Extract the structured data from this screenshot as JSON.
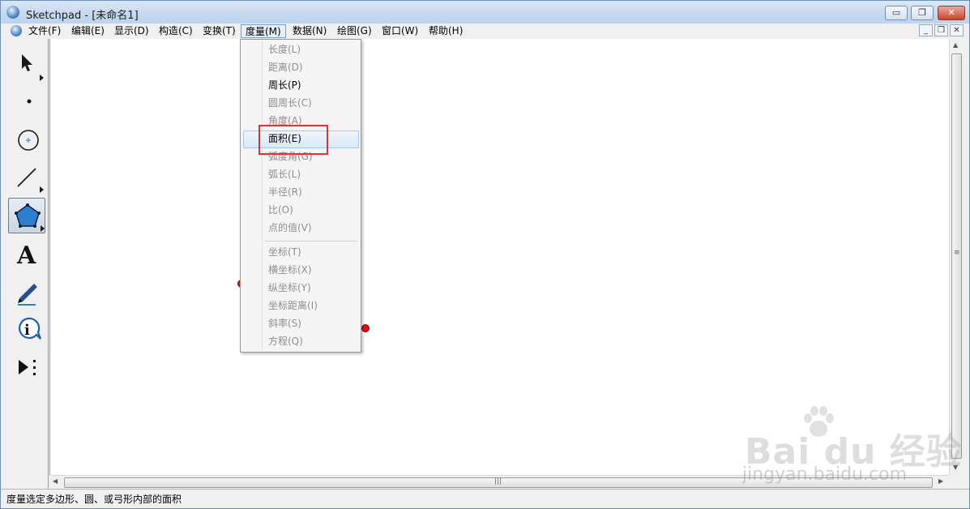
{
  "window": {
    "title": "Sketchpad  - [未命名1]",
    "controls": {
      "minimize": "▭",
      "restore": "❐",
      "close": "✕"
    }
  },
  "menubar": {
    "items": [
      {
        "label": "文件(F)"
      },
      {
        "label": "编辑(E)"
      },
      {
        "label": "显示(D)"
      },
      {
        "label": "构造(C)"
      },
      {
        "label": "变换(T)"
      },
      {
        "label": "度量(M)"
      },
      {
        "label": "数据(N)"
      },
      {
        "label": "绘图(G)"
      },
      {
        "label": "窗口(W)"
      },
      {
        "label": "帮助(H)"
      }
    ],
    "active_index": 5,
    "mdi_controls": {
      "minimize": "_",
      "restore": "❐",
      "close": "✕"
    }
  },
  "measure_menu": {
    "items": [
      {
        "label": "长度(L)",
        "enabled": false
      },
      {
        "label": "距离(D)",
        "enabled": false
      },
      {
        "label": "周长(P)",
        "enabled": true
      },
      {
        "label": "圆周长(C)",
        "enabled": false
      },
      {
        "label": "角度(A)",
        "enabled": false
      },
      {
        "label": "面积(E)",
        "enabled": true,
        "highlighted": true
      },
      {
        "label": "弧度角(G)",
        "enabled": false
      },
      {
        "label": "弧长(L)",
        "enabled": false
      },
      {
        "label": "半径(R)",
        "enabled": false
      },
      {
        "label": "比(O)",
        "enabled": false
      },
      {
        "label": "点的值(V)",
        "enabled": false
      },
      {
        "label": "坐标(T)",
        "enabled": false
      },
      {
        "label": "横坐标(X)",
        "enabled": false
      },
      {
        "label": "纵坐标(Y)",
        "enabled": false
      },
      {
        "label": "坐标距离(I)",
        "enabled": false
      },
      {
        "label": "斜率(S)",
        "enabled": false
      },
      {
        "label": "方程(Q)",
        "enabled": false
      }
    ]
  },
  "toolbox": {
    "tools": [
      {
        "icon": "arrow-select-icon"
      },
      {
        "icon": "point-icon"
      },
      {
        "icon": "compass-icon"
      },
      {
        "icon": "straightedge-icon"
      },
      {
        "icon": "polygon-icon",
        "selected": true
      },
      {
        "icon": "text-icon",
        "glyph": "A"
      },
      {
        "icon": "marker-icon"
      },
      {
        "icon": "information-icon",
        "glyph": "i"
      },
      {
        "icon": "custom-tool-icon"
      }
    ]
  },
  "statusbar": {
    "text": "度量选定多边形、圆、或弓形内部的面积"
  },
  "watermark": {
    "logo": "Bai du 经验",
    "url": "jingyan.baidu.com"
  },
  "colors": {
    "point": "#e01010",
    "highlight_box": "#e53030",
    "polygon_tool": "#2f7fd0"
  }
}
